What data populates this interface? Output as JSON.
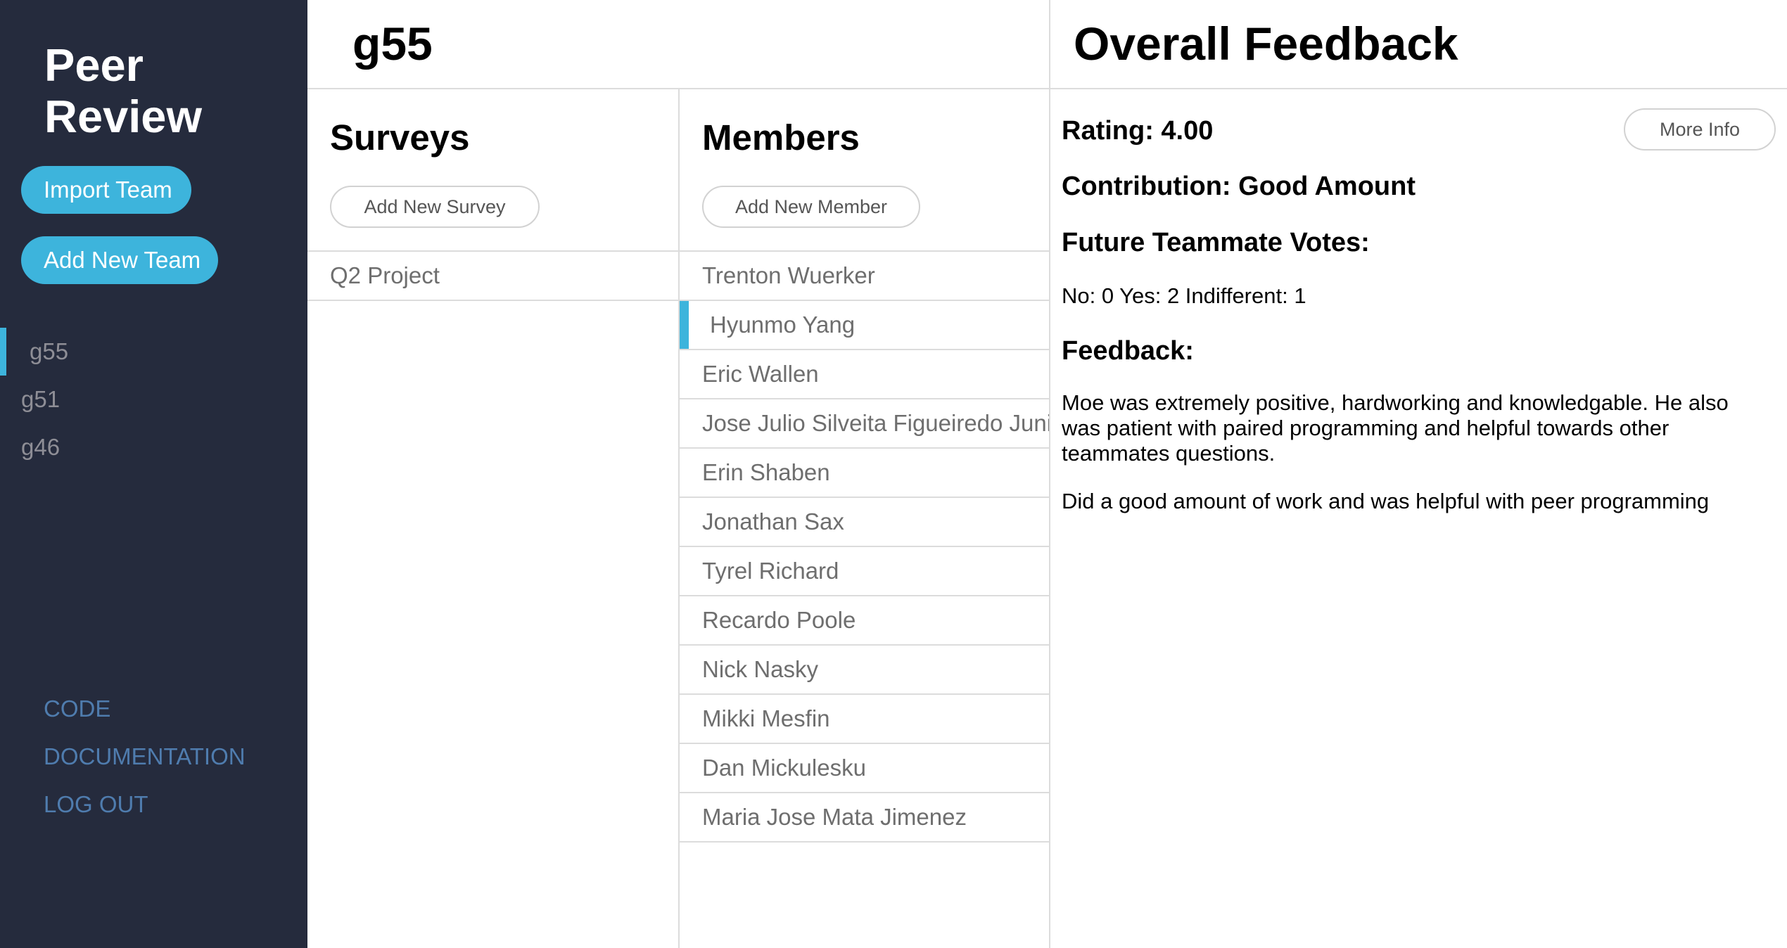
{
  "sidebar": {
    "title": "Peer Review",
    "import_team_label": "Import Team",
    "add_team_label": "Add New Team",
    "teams": [
      "g55",
      "g51",
      "g46"
    ],
    "active_team": "g55",
    "links": [
      "CODE",
      "DOCUMENTATION",
      "LOG OUT"
    ]
  },
  "header": {
    "team_name": "g55"
  },
  "surveys": {
    "heading": "Surveys",
    "add_label": "Add New Survey",
    "items": [
      "Q2 Project"
    ]
  },
  "members": {
    "heading": "Members",
    "add_label": "Add New Member",
    "selected": "Hyunmo Yang",
    "items": [
      "Trenton Wuerker",
      "Hyunmo Yang",
      "Eric Wallen",
      "Jose Julio Silveita Figueiredo Junior",
      "Erin Shaben",
      "Jonathan Sax",
      "Tyrel Richard",
      "Recardo Poole",
      "Nick Nasky",
      "Mikki Mesfin",
      "Dan Mickulesku",
      "Maria Jose Mata Jimenez"
    ]
  },
  "feedback": {
    "title": "Overall Feedback",
    "rating": "Rating: 4.00",
    "contribution": "Contribution: Good Amount",
    "votes_heading": "Future Teammate Votes:",
    "votes": "No: 0 Yes: 2 Indifferent: 1",
    "feedback_heading": "Feedback:",
    "comments": [
      "Moe was extremely positive, hardworking and knowledgable. He also was patient with paired programming and helpful towards other teammates questions.",
      "Did a good amount of work and was helpful with peer programming"
    ],
    "more_info_label": "More Info"
  },
  "colors": {
    "sidebar_bg": "#252b3d",
    "accent": "#3db4dc",
    "link": "#4f7cae"
  }
}
